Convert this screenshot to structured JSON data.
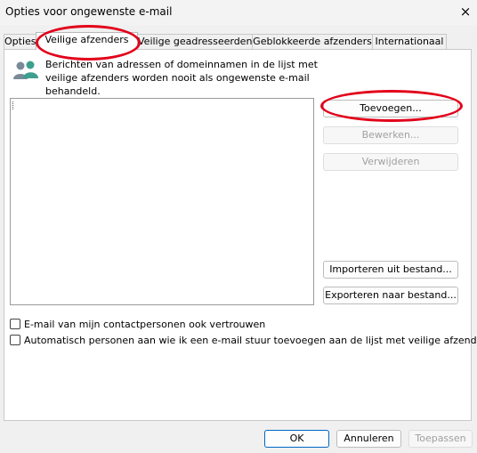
{
  "window": {
    "title": "Opties voor ongewenste e-mail",
    "close_icon": "×"
  },
  "tabs": [
    {
      "label": "Opties",
      "active": false
    },
    {
      "label": "Veilige afzenders",
      "active": true
    },
    {
      "label": "Veilige geadresseerden",
      "active": false
    },
    {
      "label": "Geblokkeerde afzenders",
      "active": false
    },
    {
      "label": "Internationaal",
      "active": false
    }
  ],
  "panel": {
    "icon": "people-icon",
    "info_text": "Berichten van adressen of domeinnamen in de lijst met veilige afzenders worden nooit als ongewenste e-mail behandeld.",
    "list_items": [],
    "buttons": {
      "add": "Toevoegen...",
      "edit": "Bewerken...",
      "remove": "Verwijderen",
      "import": "Importeren uit bestand...",
      "export": "Exporteren naar bestand..."
    },
    "checkboxes": [
      {
        "label": "E-mail van mijn contactpersonen ook vertrouwen",
        "checked": false
      },
      {
        "label": "Automatisch personen aan wie ik een e-mail stuur toevoegen aan de lijst met veilige afzenders",
        "checked": false
      }
    ]
  },
  "footer": {
    "ok": "OK",
    "cancel": "Annuleren",
    "apply": "Toepassen"
  },
  "colors": {
    "annotation": "#e2001a",
    "default_button_border": "#0067c0"
  }
}
